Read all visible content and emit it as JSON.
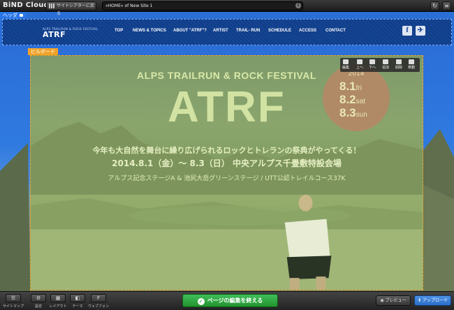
{
  "app": {
    "title": "BiND Cloud"
  },
  "toolbar": {
    "back_label": "サイトシアターに戻る",
    "url_value": "«HOME» of New Site 1",
    "info_icon": "info-icon",
    "refresh_icon": "refresh-icon",
    "menu_icon": "menu-icon"
  },
  "zones": {
    "header_label": "ヘッダ",
    "billboard_label": "ビルボード"
  },
  "site": {
    "logo_small": "ALPS TRAILRUN & ROCK FESTIVAL",
    "logo_big": "ATRF",
    "nav": [
      "TOP",
      "NEWS & TOPICS",
      "ABOUT \"ATRF\"?",
      "ARTIST",
      "TRAIL- RUN",
      "SCHEDULE",
      "ACCESS",
      "CONTACT"
    ],
    "social": [
      "f",
      "✈"
    ]
  },
  "hero": {
    "subtitle": "ALPS TRAILRUN & ROCK FESTIVAL",
    "title": "ATRF",
    "year": "2014",
    "dates": [
      {
        "num": "8.1",
        "day": "fri"
      },
      {
        "num": "8.2",
        "day": "sat"
      },
      {
        "num": "8.3",
        "day": "sun"
      }
    ],
    "tagline": "今年も大自然を舞台に繰り広げられるロックとトレランの祭典がやってくる！",
    "dateline": "2014.8.1（金）～ 8.3（日） 中央アルプス千畳敷特設会場",
    "stages": "アルプス記念ステージA & 池尻大岳グリーンステージ / UTT公認トレイルコース37K"
  },
  "edit_tools": [
    "編集",
    "上へ",
    "下へ",
    "追加",
    "削除",
    "移動"
  ],
  "bottom": {
    "tools": [
      "サイトマップ",
      "設定",
      "レイアウト",
      "テーマ",
      "ウェブフォント"
    ],
    "finish_label": "ページの編集を終える",
    "preview_label": "プレビュー",
    "upload_label": "アップロード"
  }
}
